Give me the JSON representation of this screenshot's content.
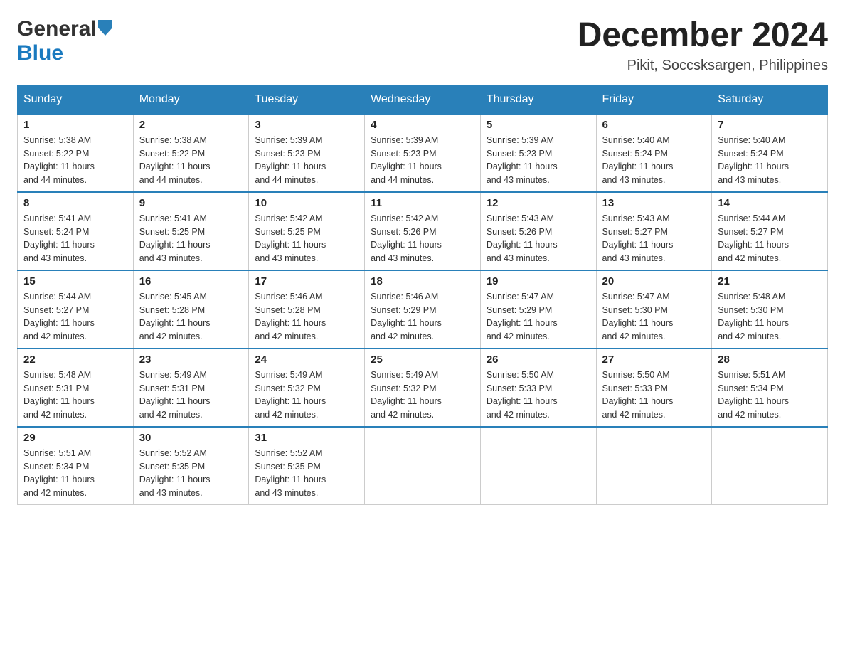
{
  "header": {
    "month_title": "December 2024",
    "location": "Pikit, Soccsksargen, Philippines",
    "logo_general": "General",
    "logo_blue": "Blue"
  },
  "calendar": {
    "days_of_week": [
      "Sunday",
      "Monday",
      "Tuesday",
      "Wednesday",
      "Thursday",
      "Friday",
      "Saturday"
    ],
    "weeks": [
      [
        {
          "day": "1",
          "sunrise": "5:38 AM",
          "sunset": "5:22 PM",
          "daylight": "11 hours and 44 minutes."
        },
        {
          "day": "2",
          "sunrise": "5:38 AM",
          "sunset": "5:22 PM",
          "daylight": "11 hours and 44 minutes."
        },
        {
          "day": "3",
          "sunrise": "5:39 AM",
          "sunset": "5:23 PM",
          "daylight": "11 hours and 44 minutes."
        },
        {
          "day": "4",
          "sunrise": "5:39 AM",
          "sunset": "5:23 PM",
          "daylight": "11 hours and 44 minutes."
        },
        {
          "day": "5",
          "sunrise": "5:39 AM",
          "sunset": "5:23 PM",
          "daylight": "11 hours and 43 minutes."
        },
        {
          "day": "6",
          "sunrise": "5:40 AM",
          "sunset": "5:24 PM",
          "daylight": "11 hours and 43 minutes."
        },
        {
          "day": "7",
          "sunrise": "5:40 AM",
          "sunset": "5:24 PM",
          "daylight": "11 hours and 43 minutes."
        }
      ],
      [
        {
          "day": "8",
          "sunrise": "5:41 AM",
          "sunset": "5:24 PM",
          "daylight": "11 hours and 43 minutes."
        },
        {
          "day": "9",
          "sunrise": "5:41 AM",
          "sunset": "5:25 PM",
          "daylight": "11 hours and 43 minutes."
        },
        {
          "day": "10",
          "sunrise": "5:42 AM",
          "sunset": "5:25 PM",
          "daylight": "11 hours and 43 minutes."
        },
        {
          "day": "11",
          "sunrise": "5:42 AM",
          "sunset": "5:26 PM",
          "daylight": "11 hours and 43 minutes."
        },
        {
          "day": "12",
          "sunrise": "5:43 AM",
          "sunset": "5:26 PM",
          "daylight": "11 hours and 43 minutes."
        },
        {
          "day": "13",
          "sunrise": "5:43 AM",
          "sunset": "5:27 PM",
          "daylight": "11 hours and 43 minutes."
        },
        {
          "day": "14",
          "sunrise": "5:44 AM",
          "sunset": "5:27 PM",
          "daylight": "11 hours and 42 minutes."
        }
      ],
      [
        {
          "day": "15",
          "sunrise": "5:44 AM",
          "sunset": "5:27 PM",
          "daylight": "11 hours and 42 minutes."
        },
        {
          "day": "16",
          "sunrise": "5:45 AM",
          "sunset": "5:28 PM",
          "daylight": "11 hours and 42 minutes."
        },
        {
          "day": "17",
          "sunrise": "5:46 AM",
          "sunset": "5:28 PM",
          "daylight": "11 hours and 42 minutes."
        },
        {
          "day": "18",
          "sunrise": "5:46 AM",
          "sunset": "5:29 PM",
          "daylight": "11 hours and 42 minutes."
        },
        {
          "day": "19",
          "sunrise": "5:47 AM",
          "sunset": "5:29 PM",
          "daylight": "11 hours and 42 minutes."
        },
        {
          "day": "20",
          "sunrise": "5:47 AM",
          "sunset": "5:30 PM",
          "daylight": "11 hours and 42 minutes."
        },
        {
          "day": "21",
          "sunrise": "5:48 AM",
          "sunset": "5:30 PM",
          "daylight": "11 hours and 42 minutes."
        }
      ],
      [
        {
          "day": "22",
          "sunrise": "5:48 AM",
          "sunset": "5:31 PM",
          "daylight": "11 hours and 42 minutes."
        },
        {
          "day": "23",
          "sunrise": "5:49 AM",
          "sunset": "5:31 PM",
          "daylight": "11 hours and 42 minutes."
        },
        {
          "day": "24",
          "sunrise": "5:49 AM",
          "sunset": "5:32 PM",
          "daylight": "11 hours and 42 minutes."
        },
        {
          "day": "25",
          "sunrise": "5:49 AM",
          "sunset": "5:32 PM",
          "daylight": "11 hours and 42 minutes."
        },
        {
          "day": "26",
          "sunrise": "5:50 AM",
          "sunset": "5:33 PM",
          "daylight": "11 hours and 42 minutes."
        },
        {
          "day": "27",
          "sunrise": "5:50 AM",
          "sunset": "5:33 PM",
          "daylight": "11 hours and 42 minutes."
        },
        {
          "day": "28",
          "sunrise": "5:51 AM",
          "sunset": "5:34 PM",
          "daylight": "11 hours and 42 minutes."
        }
      ],
      [
        {
          "day": "29",
          "sunrise": "5:51 AM",
          "sunset": "5:34 PM",
          "daylight": "11 hours and 42 minutes."
        },
        {
          "day": "30",
          "sunrise": "5:52 AM",
          "sunset": "5:35 PM",
          "daylight": "11 hours and 43 minutes."
        },
        {
          "day": "31",
          "sunrise": "5:52 AM",
          "sunset": "5:35 PM",
          "daylight": "11 hours and 43 minutes."
        },
        null,
        null,
        null,
        null
      ]
    ],
    "labels": {
      "sunrise": "Sunrise:",
      "sunset": "Sunset:",
      "daylight": "Daylight:"
    }
  }
}
